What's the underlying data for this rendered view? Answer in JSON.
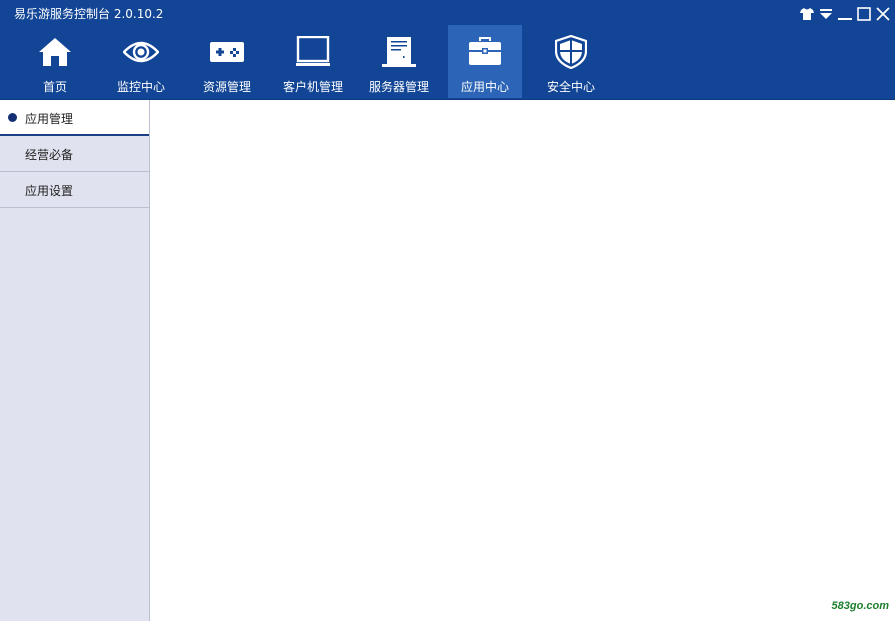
{
  "window": {
    "title": "易乐游服务控制台 2.0.10.2",
    "controls": [
      "shirt-icon",
      "dropdown-icon",
      "minimize-icon",
      "maximize-icon",
      "close-icon"
    ]
  },
  "nav": {
    "items": [
      {
        "label": "首页",
        "icon": "home-icon"
      },
      {
        "label": "监控中心",
        "icon": "eye-icon"
      },
      {
        "label": "资源管理",
        "icon": "gamepad-icon"
      },
      {
        "label": "客户机管理",
        "icon": "monitor-icon"
      },
      {
        "label": "服务器管理",
        "icon": "server-icon"
      },
      {
        "label": "应用中心",
        "icon": "toolbox-icon",
        "active": true
      },
      {
        "label": "安全中心",
        "icon": "shield-icon"
      }
    ]
  },
  "sidebar": {
    "items": [
      {
        "label": "应用管理",
        "active": true
      },
      {
        "label": "经营必备"
      },
      {
        "label": "应用设置"
      }
    ]
  },
  "watermark": "583go.com",
  "colors": {
    "header": "#124596",
    "active_tab": "#2c64b7",
    "sidebar": "#e0e3ef",
    "watermark": "#1d7f2e"
  }
}
